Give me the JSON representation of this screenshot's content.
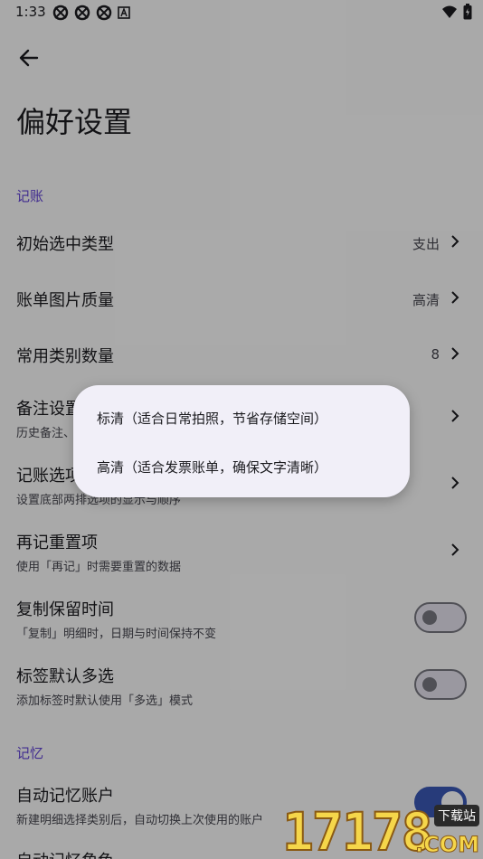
{
  "status_bar": {
    "time": "1:33",
    "notif_icons": [
      "sync-icon",
      "sync-icon",
      "sync-icon",
      "keyboard-a-icon"
    ],
    "right_icons": [
      "wifi-icon",
      "battery-icon"
    ]
  },
  "header": {
    "back_icon": "arrow-left-icon",
    "title": "偏好设置"
  },
  "sections": {
    "bookkeeping": "记账",
    "memory": "记忆"
  },
  "rows": {
    "initial_type": {
      "title": "初始选中类型",
      "value": "支出"
    },
    "image_quality": {
      "title": "账单图片质量",
      "value": "高清"
    },
    "common_category_count": {
      "title": "常用类别数量",
      "value": "8"
    },
    "note_settings": {
      "title": "备注设置",
      "subtitle": "历史备注、"
    },
    "options": {
      "title": "记账选项",
      "subtitle": "设置底部两排选项的显示与顺序"
    },
    "re_record_reset": {
      "title": "再记重置项",
      "subtitle": "使用「再记」时需要重置的数据"
    },
    "copy_keep_time": {
      "title": "复制保留时间",
      "subtitle": "「复制」明细时，日期与时间保持不变",
      "on": false
    },
    "tag_multi_select": {
      "title": "标签默认多选",
      "subtitle": "添加标签时默认使用「多选」模式",
      "on": false
    },
    "auto_remember_account": {
      "title": "自动记忆账户",
      "subtitle": "新建明细选择类别后，自动切换上次使用的账户",
      "on": true
    },
    "auto_remember_role": {
      "title": "自动记忆角色"
    }
  },
  "popup": {
    "items": [
      "标清（适合日常拍照，节省存储空间）",
      "高清（适合发票账单，确保文字清晰）"
    ]
  },
  "watermark": {
    "digits": "17178",
    "suffix": ".COM",
    "tag": "下载站"
  },
  "colors": {
    "background": "#fafafa",
    "accent": "#5d3fd3",
    "toggle_on": "#3a58b4",
    "scrim": "rgba(0,0,0,0.32)",
    "popup": "#f1eff8"
  }
}
